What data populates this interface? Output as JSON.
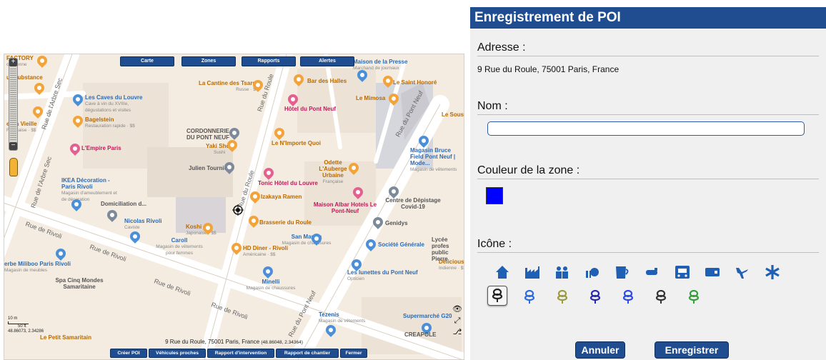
{
  "map": {
    "top_buttons": [
      "Carte",
      "Zones",
      "Rapports",
      "Alertes"
    ],
    "bottom_buttons": [
      "Créer POI",
      "Véhicules proches",
      "Rapport d'intervention",
      "Rapport de chantier",
      "Fermer"
    ],
    "address": "9 Rue du Roule, 75001 Paris, France",
    "coords": "(48.86048, 2.34364)",
    "scale": {
      "m": "10 m",
      "ft": "50 ft",
      "latlon": "48.86073, 2.34286"
    },
    "streets": [
      "Rue de l'Arbre Sec",
      "Rue du Roule",
      "Rue du Pont Neuf",
      "Rue de Rivoli",
      "Rue de Rivoli",
      "Rue du Pont Neuf",
      "Rue de Rivoli",
      "Rue de Rivoli",
      "Rue du Roule",
      "Rue de l'Arbre Sec"
    ],
    "pois": [
      {
        "name": "FACTORY",
        "sub": "ouvrienne",
        "color": "orange"
      },
      {
        "name": "ur Substance",
        "sub": "",
        "color": "orange"
      },
      {
        "name": "Les Caves du Louvre",
        "sub": "Cave à vin du XVIIIe, dégustations et visites",
        "color": "blue"
      },
      {
        "name": "Bagelstein",
        "sub": "Restauration rapide · $$",
        "color": "orange"
      },
      {
        "name": "ez la Vieille",
        "sub": "Française · $$",
        "color": "orange"
      },
      {
        "name": "L'Empire Paris",
        "sub": "",
        "color": "pink"
      },
      {
        "name": "IKEA Décoration - Paris Rivoli",
        "sub": "Magasin d'ameublement et de décoration",
        "color": "blue"
      },
      {
        "name": "Domiciliation d...",
        "sub": "",
        "color": "dark"
      },
      {
        "name": "Nicolas Rivoli",
        "sub": "Caviste",
        "color": "blue"
      },
      {
        "name": "Koshi",
        "sub": "Japonaise · $$",
        "color": "orange"
      },
      {
        "name": "Caroll",
        "sub": "Magasin de vêtements pour femmes",
        "color": "blue"
      },
      {
        "name": "erbe Miliboo Paris Rivoli",
        "sub": "Magasin de meubles",
        "color": "blue"
      },
      {
        "name": "Spa Cinq Mondes Samaritaine",
        "sub": "",
        "color": "dark"
      },
      {
        "name": "La Cantine des Tsars",
        "sub": "Russe · $",
        "color": "orange"
      },
      {
        "name": "Bar des Halles",
        "sub": "",
        "color": "orange"
      },
      {
        "name": "Maison de la Presse",
        "sub": "Marchand de journaux",
        "color": "blue"
      },
      {
        "name": "Le Saint Honoré",
        "sub": "",
        "color": "orange"
      },
      {
        "name": "Le Mimosa",
        "sub": "",
        "color": "orange"
      },
      {
        "name": "Hôtel du Pont Neuf",
        "sub": "",
        "color": "pink"
      },
      {
        "name": "CORDONNERIE DU PONT NEUF",
        "sub": "",
        "color": "dark"
      },
      {
        "name": "Yaki Shop",
        "sub": "Sushi",
        "color": "orange"
      },
      {
        "name": "Le N'Importe Quoi",
        "sub": "",
        "color": "orange"
      },
      {
        "name": "Julien Tournier",
        "sub": "",
        "color": "dark"
      },
      {
        "name": "Odette L'Auberge Urbaine",
        "sub": "Française",
        "color": "orange"
      },
      {
        "name": "Tonic Hôtel du Louvre",
        "sub": "",
        "color": "pink"
      },
      {
        "name": "Izakaya Ramen",
        "sub": "",
        "color": "orange"
      },
      {
        "name": "Maison Albar Hotels Le Pont-Neuf",
        "sub": "",
        "color": "pink"
      },
      {
        "name": "Brasserie du Roule",
        "sub": "",
        "color": "orange"
      },
      {
        "name": "San Marina",
        "sub": "Magasin de chaussures",
        "color": "blue"
      },
      {
        "name": "HD Diner - Rivoli",
        "sub": "Américaine · $$",
        "color": "orange"
      },
      {
        "name": "Minelli",
        "sub": "Magasin de chaussures",
        "color": "blue"
      },
      {
        "name": "Le Sous",
        "sub": "",
        "color": "orange"
      },
      {
        "name": "Magasin Bruce Field Pont Neuf | Mode...",
        "sub": "Magasin de vêtements",
        "color": "blue"
      },
      {
        "name": "Centre de Dépistage Covid-19",
        "sub": "",
        "color": "dark"
      },
      {
        "name": "Genidys",
        "sub": "",
        "color": "dark"
      },
      {
        "name": "Société Générale",
        "sub": "",
        "color": "blue"
      },
      {
        "name": "Lycée profes public Pierre",
        "sub": "",
        "color": "dark"
      },
      {
        "name": "Les lunettes du Pont Neuf",
        "sub": "Opticien",
        "color": "blue"
      },
      {
        "name": "Délicious",
        "sub": "Indienne · $$",
        "color": "orange"
      },
      {
        "name": "Tezenis",
        "sub": "Magasin de vêtements",
        "color": "blue"
      },
      {
        "name": "Supermarché G20",
        "sub": "",
        "color": "blue"
      },
      {
        "name": "CREAPOLE",
        "sub": "",
        "color": "dark"
      },
      {
        "name": "Le Petit Samaritain",
        "sub": "",
        "color": "orange"
      }
    ]
  },
  "panel": {
    "title": "Enregistrement de POI",
    "address_label": "Adresse :",
    "address_value": "9 Rue du Roule, 75001 Paris, France",
    "name_label": "Nom :",
    "name_value": "",
    "color_label": "Couleur de la zone :",
    "zone_color": "#0000ff",
    "icon_label": "Icône :",
    "icons_row1": [
      "home-icon",
      "factory-icon",
      "people-icon",
      "office-icon",
      "cup-icon",
      "pipe-icon",
      "car-icon",
      "truck-icon",
      "airplane-icon",
      "asterisk-icon"
    ],
    "icons_row2_colors": [
      "#222222",
      "#2d6be0",
      "#9c9c3c",
      "#2a2ab0",
      "#2d4be8",
      "#333333",
      "#34a03c"
    ],
    "selected_icon": 0,
    "cancel_label": "Annuler",
    "save_label": "Enregistrer"
  }
}
